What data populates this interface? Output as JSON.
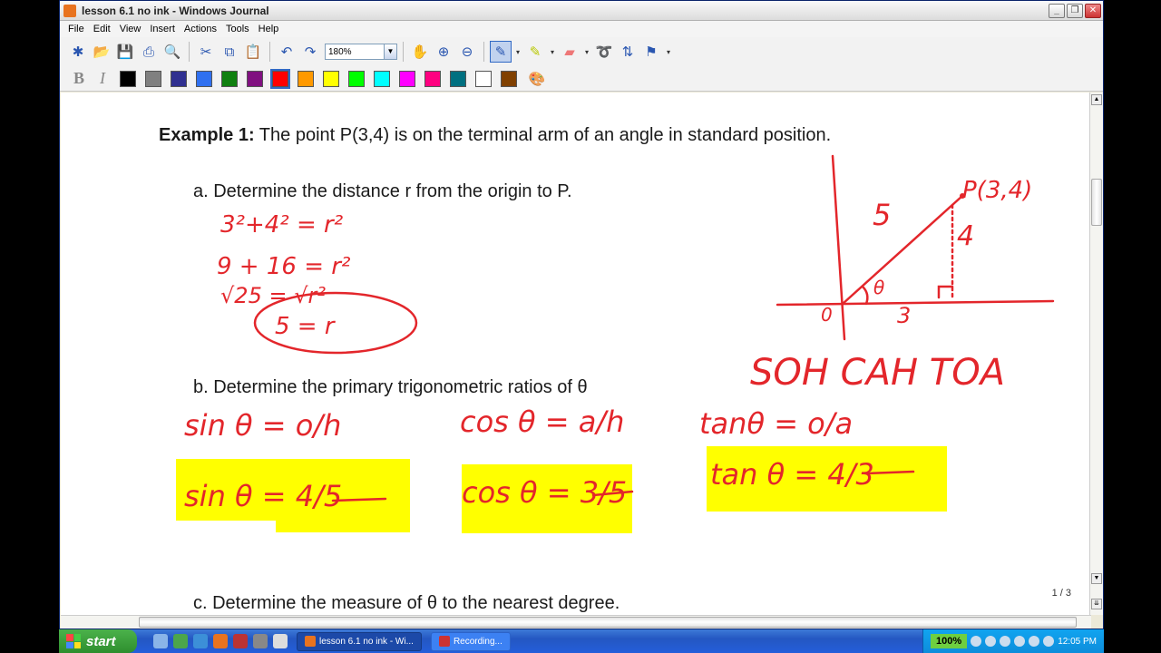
{
  "window": {
    "title": "lesson 6.1 no ink - Windows Journal",
    "controls": {
      "minimize": "_",
      "restore": "❐",
      "close": "✕"
    }
  },
  "menu": [
    "File",
    "Edit",
    "View",
    "Insert",
    "Actions",
    "Tools",
    "Help"
  ],
  "toolbar": {
    "zoom_value": "180%"
  },
  "format": {
    "bold": "B",
    "italic": "I"
  },
  "colors": [
    "#000000",
    "#808080",
    "#303090",
    "#3070f0",
    "#108010",
    "#801080",
    "#ff0000",
    "#ff9900",
    "#ffff00",
    "#00ff00",
    "#00ffff",
    "#ff00ff",
    "#ff0080",
    "#007080",
    "#ffffff",
    "#804000"
  ],
  "selected_color_index": 6,
  "document": {
    "example_label": "Example 1:",
    "example_text": " The point P(3,4) is on the terminal arm of an angle in standard position.",
    "part_a": "a.   Determine the distance r from the origin to P.",
    "part_b": "b.   Determine the primary trigonometric ratios of θ",
    "part_c": "c.   Determine the measure of θ to the nearest degree.",
    "page_indicator": "1 / 3",
    "ink_accent": "#e3262b",
    "highlight_color": "#ffff00"
  },
  "ink": {
    "a1": "3²+4² = r²",
    "a2": "9 + 16  = r²",
    "a3": "√25  = √r²",
    "a4": "5  = r",
    "label_5": "5",
    "label_4": "4",
    "label_3": "3",
    "label_0": "0",
    "label_theta": "θ",
    "point_label": "P(3,4)",
    "soh_cah_toa": "SOH  CAH  TOA",
    "sin_def": "sin θ = o/h",
    "cos_def": "cos θ = a/h",
    "tan_def": "tanθ = o/a",
    "sin_val": "sin θ = 4/5",
    "cos_val": "cos θ = 3/5",
    "tan_val": "tan θ = 4/3"
  },
  "taskbar": {
    "start": "start",
    "task1": "lesson 6.1 no ink - Wi...",
    "task2": "Recording...",
    "zoom": "100%",
    "clock": "12:05 PM"
  }
}
